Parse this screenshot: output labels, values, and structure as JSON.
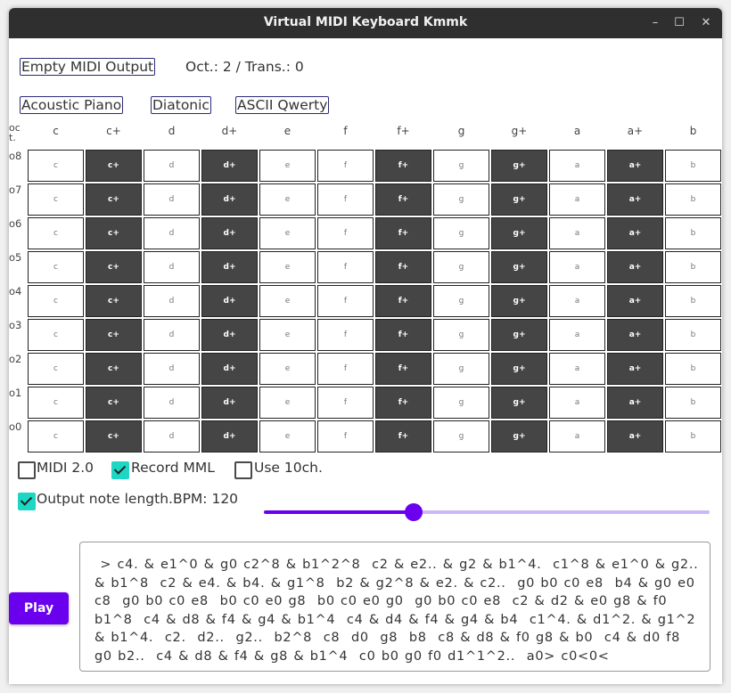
{
  "window": {
    "title": "Virtual MIDI Keyboard Kmmk",
    "minimize_glyph": "–",
    "maximize_glyph": "☐",
    "close_glyph": "✕"
  },
  "toolbar": {
    "output_button": "Empty MIDI Output",
    "oct_trans": "Oct.: 2 / Trans.: 0",
    "instrument_button": "Acoustic Piano",
    "scale_button": "Diatonic",
    "layout_button": "ASCII Qwerty"
  },
  "keyboard": {
    "octave_header": "oc\nt.",
    "columns": [
      "c",
      "c+",
      "d",
      "d+",
      "e",
      "f",
      "f+",
      "g",
      "g+",
      "a",
      "a+",
      "b"
    ],
    "black_keys": [
      false,
      true,
      false,
      true,
      false,
      false,
      true,
      false,
      true,
      false,
      true,
      false
    ],
    "rows": [
      "o8",
      "o7",
      "o6",
      "o5",
      "o4",
      "o3",
      "o2",
      "o1",
      "o0"
    ]
  },
  "options": {
    "midi2": {
      "label": "MIDI 2.0",
      "checked": false
    },
    "record_mml": {
      "label": "Record MML",
      "checked": true
    },
    "use_10ch": {
      "label": "Use 10ch.",
      "checked": false
    },
    "output_note_length": {
      "label": "Output note length.",
      "checked": true
    },
    "bpm_label": "BPM: 120",
    "bpm_slider_fraction": 0.33
  },
  "play_button": "Play",
  "mml_text": " > c4. & e1^0 & g0 c2^8 & b1^2^8  c2 & e2.. & g2 & b1^4.  c1^8 & e1^0 & g2.. & b1^8  c2 & e4. & b4. & g1^8  b2 & g2^8 & e2. & c2..  g0 b0 c0 e8  b4 & g0 e0 c8  g0 b0 c0 e8  b0 c0 e0 g8  b0 c0 e0 g0  g0 b0 c0 e8  c2 & d2 & e0 g8 & f0 b1^8  c4 & d8 & f4 & g4 & b1^4  c4 & d4 & f4 & g4 & b4  c1^4. & d1^2. & g1^2 & b1^4.  c2.  d2..  g2..  b2^8  c8  d0  g8  b8  c8 & d8 & f0 g8 & b0  c4 & d0 f8  g0 b2..  c4 & d8 & f4 & g8 & b1^4  c0 b0 g0 f0 d1^1^2..  a0> c0<0<"
}
